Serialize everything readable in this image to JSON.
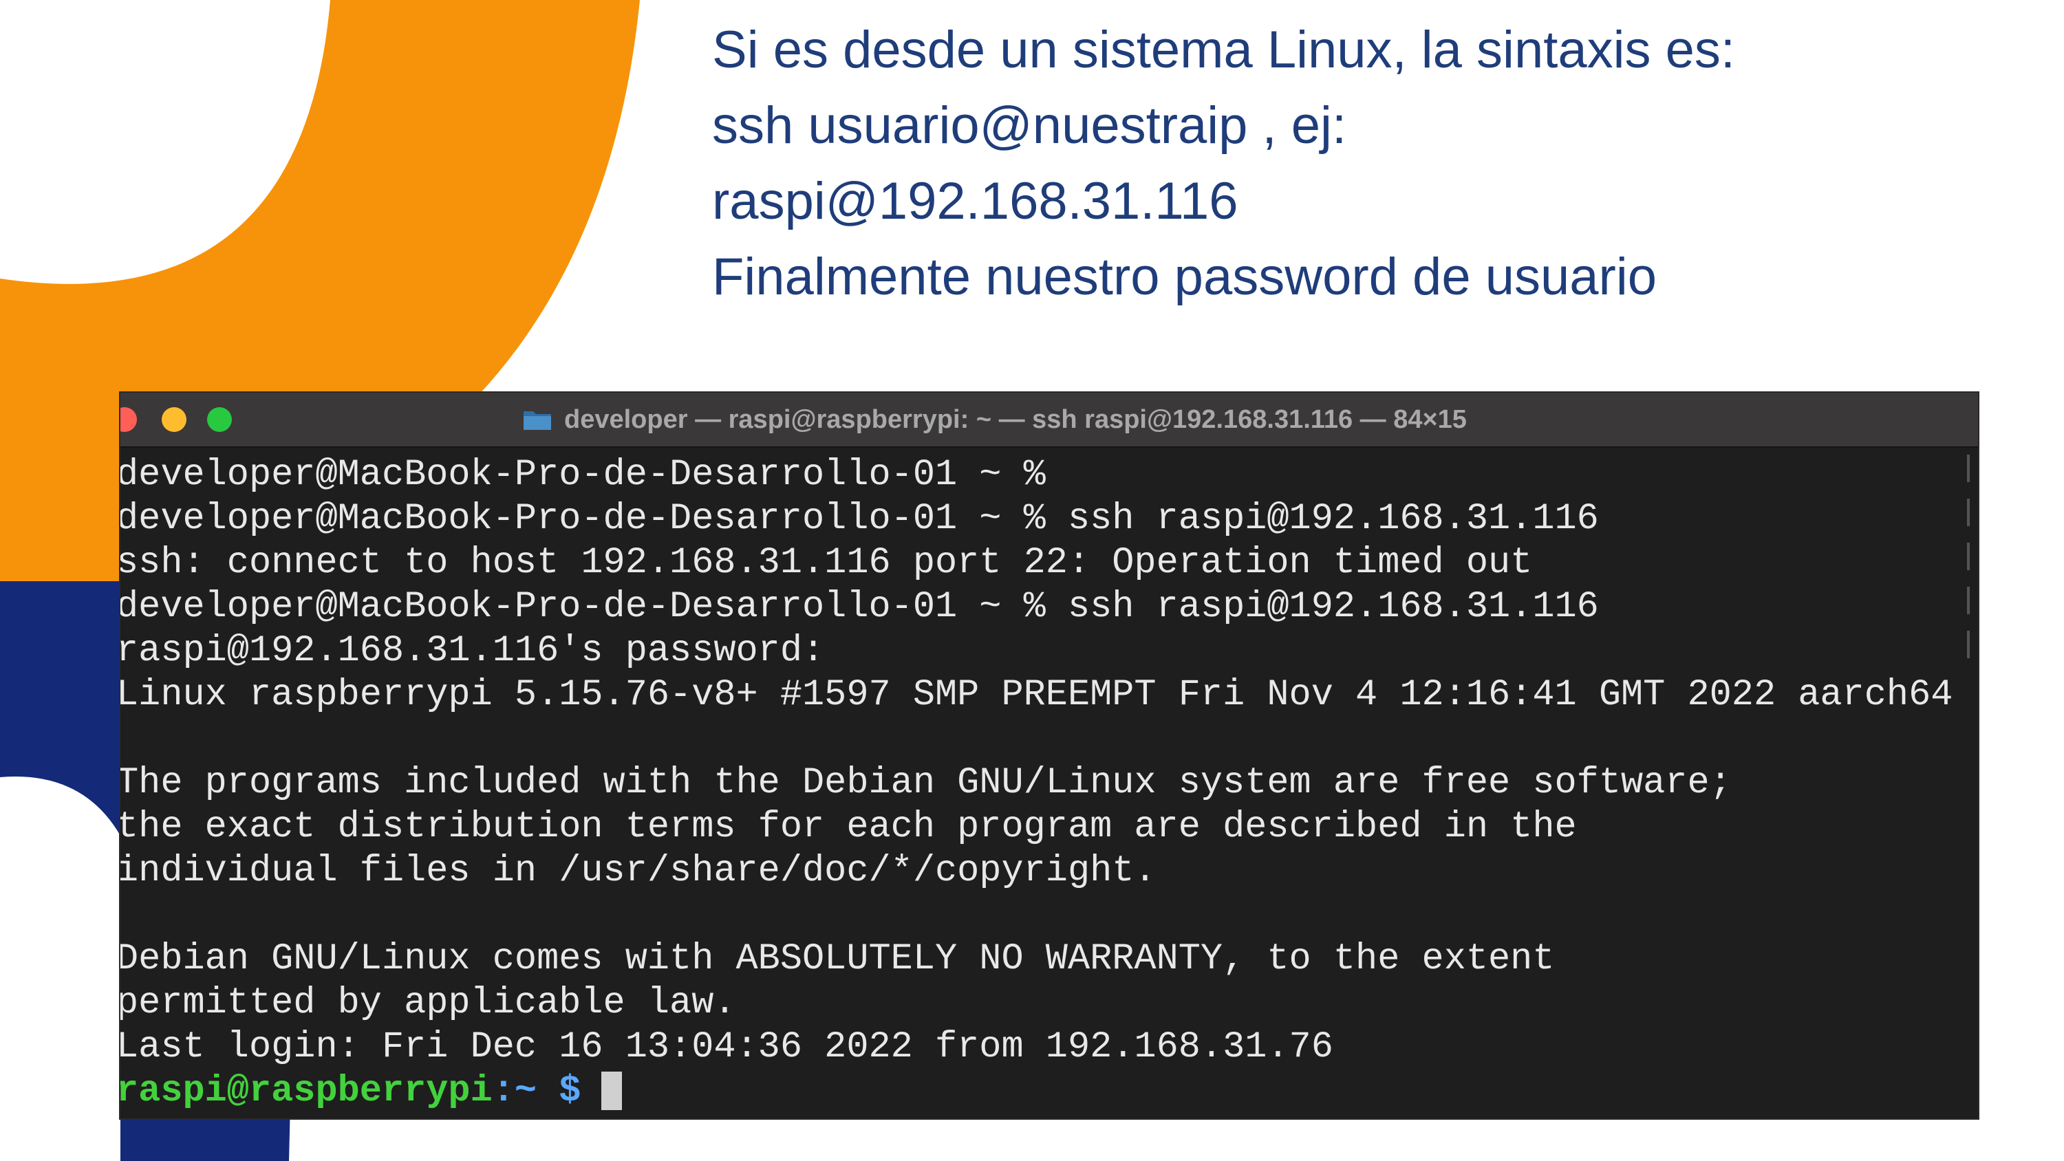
{
  "colors": {
    "orange": "#f7930a",
    "navy": "#142a78",
    "caption_text": "#1f3d7a",
    "terminal_bg": "#1e1e1e",
    "titlebar_bg": "#3a3838",
    "prompt_user": "#43d13d",
    "prompt_path": "#5ba8ff"
  },
  "caption": {
    "lines": [
      "Si es desde un sistema Linux, la sintaxis es:",
      "ssh usuario@nuestraip , ej:",
      "raspi@192.168.31.116",
      "Finalmente nuestro password de usuario"
    ]
  },
  "terminal": {
    "title_icon": "folder-icon",
    "title": "developer — raspi@raspberrypi: ~ — ssh raspi@192.168.31.116 — 84×15",
    "lines": [
      "developer@MacBook-Pro-de-Desarrollo-01 ~ %",
      "developer@MacBook-Pro-de-Desarrollo-01 ~ % ssh raspi@192.168.31.116",
      "ssh: connect to host 192.168.31.116 port 22: Operation timed out",
      "developer@MacBook-Pro-de-Desarrollo-01 ~ % ssh raspi@192.168.31.116",
      "raspi@192.168.31.116's password:",
      "Linux raspberrypi 5.15.76-v8+ #1597 SMP PREEMPT Fri Nov 4 12:16:41 GMT 2022 aarch64",
      "",
      "The programs included with the Debian GNU/Linux system are free software;",
      "the exact distribution terms for each program are described in the",
      "individual files in /usr/share/doc/*/copyright.",
      "",
      "Debian GNU/Linux comes with ABSOLUTELY NO WARRANTY, to the extent",
      "permitted by applicable law.",
      "Last login: Fri Dec 16 13:04:36 2022 from 192.168.31.76"
    ],
    "prompt": {
      "user_host": "raspi@raspberrypi",
      "separator": ":",
      "path": "~",
      "symbol": " $"
    }
  }
}
